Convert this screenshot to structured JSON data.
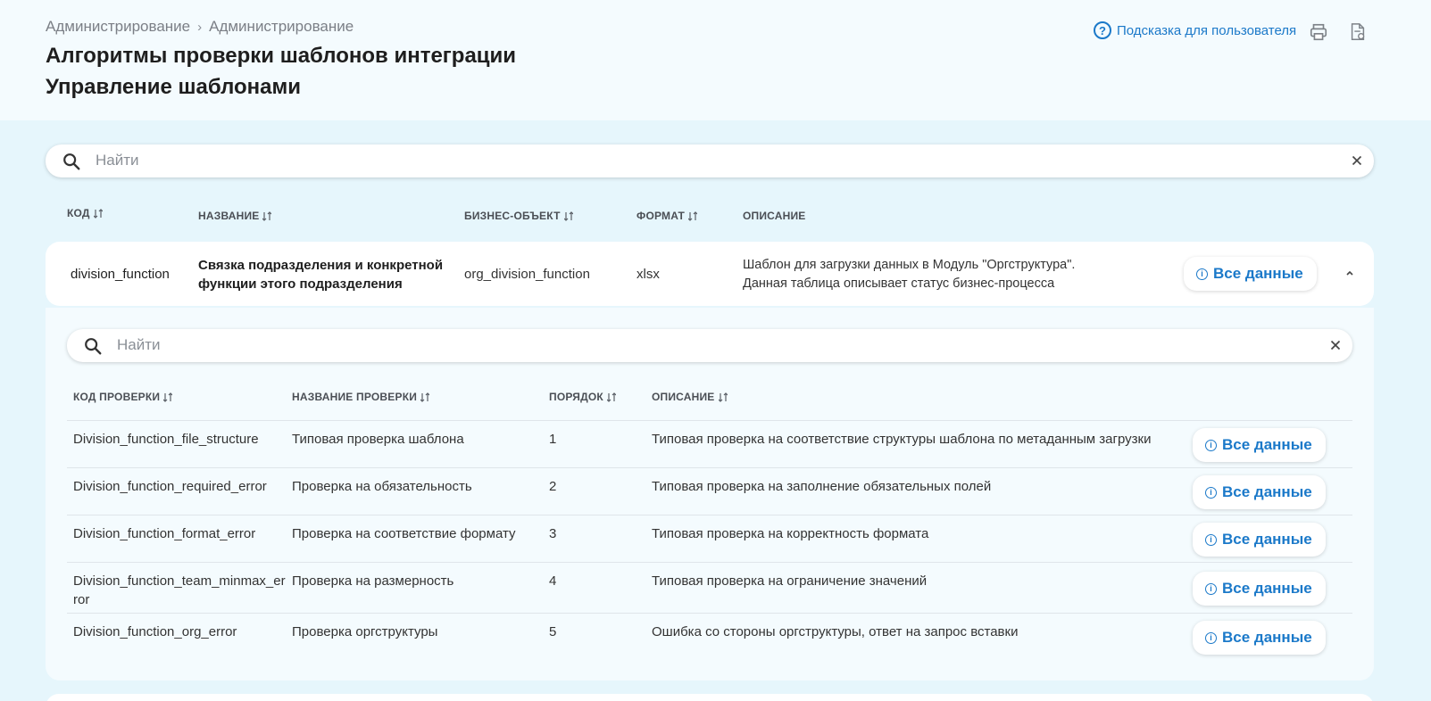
{
  "breadcrumb": {
    "items": [
      "Администрирование",
      "Администрирование"
    ],
    "separator": "›"
  },
  "page": {
    "title": "Алгоритмы проверки шаблонов интеграции",
    "subtitle": "Управление шаблонами"
  },
  "top_actions": {
    "help_label": "Подсказка для пользователя",
    "help_glyph": "?",
    "print_icon": "printer-icon",
    "export_icon": "document-export-icon"
  },
  "search_main": {
    "placeholder": "Найти",
    "value": ""
  },
  "main_table": {
    "columns": [
      "КОД",
      "НАЗВАНИЕ",
      "БИЗНЕС-ОБЪЕКТ",
      "ФОРМАТ",
      "ОПИСАНИЕ"
    ],
    "row": {
      "code": "division_function",
      "name_line1": "Связка подразделения и конкретной",
      "name_line2": "функции этого подразделения",
      "business_object": "org_division_function",
      "format": "xlsx",
      "description_line1": "Шаблон для загрузки данных в Модуль \"Оргструктура\".",
      "description_line2": "Данная таблица описывает статус бизнес-процесса",
      "button_label": "Все данные",
      "expanded": true
    }
  },
  "search_sub": {
    "placeholder": "Найти",
    "value": ""
  },
  "sub_table": {
    "columns": [
      "КОД ПРОВЕРКИ",
      "НАЗВАНИЕ ПРОВЕРКИ",
      "ПОРЯДОК",
      "ОПИСАНИЕ"
    ],
    "button_label": "Все данные",
    "info_glyph": "i",
    "rows": [
      {
        "code": "Division_function_file_structure",
        "code2": "",
        "name": "Типовая проверка шаблона",
        "order": "1",
        "description": "Типовая проверка на соответствие структуры шаблона по метаданным загрузки"
      },
      {
        "code": "Division_function_required_error",
        "code2": "",
        "name": "Проверка на обязательность",
        "order": "2",
        "description": "Типовая проверка на заполнение обязательных полей"
      },
      {
        "code": "Division_function_format_error",
        "code2": "",
        "name": "Проверка на соответствие формату",
        "order": "3",
        "description": "Типовая проверка на корректность формата"
      },
      {
        "code": "Division_function_team_minmax_er",
        "code2": "ror",
        "name": "Проверка на размерность",
        "order": "4",
        "description": "Типовая проверка на ограничение значений"
      },
      {
        "code": "Division_function_org_error",
        "code2": "",
        "name": "Проверка оргструктуры",
        "order": "5",
        "description": "Ошибка со стороны оргструктуры, ответ на запрос вставки"
      }
    ]
  },
  "colors": {
    "accent": "#1b79c9",
    "page_bg": "#e6f6fc",
    "header_bg": "#f4fbfe"
  }
}
